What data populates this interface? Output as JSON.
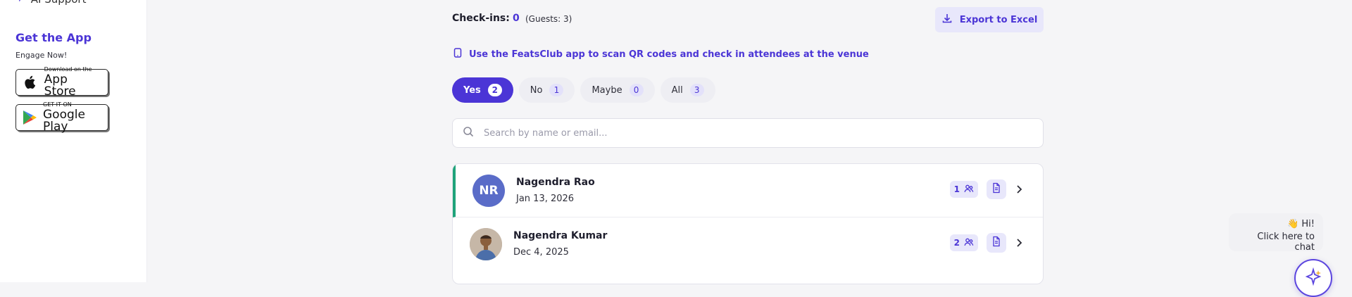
{
  "sidebar": {
    "cut_item_label": "AI Support",
    "get_app_title": "Get the App",
    "get_app_subtitle": "Engage Now!",
    "app_store": {
      "small": "Download on the",
      "big": "App Store"
    },
    "google_play": {
      "small": "GET IT ON",
      "big": "Google Play"
    }
  },
  "checkins": {
    "label": "Check-ins:",
    "count": "0",
    "guests_text": "(Guests: 3)",
    "export_label": "Export to Excel"
  },
  "tip": {
    "text": "Use the FeatsClub app to scan QR codes and check in attendees at the venue"
  },
  "filters": [
    {
      "label": "Yes",
      "count": "2",
      "active": true
    },
    {
      "label": "No",
      "count": "1",
      "active": false
    },
    {
      "label": "Maybe",
      "count": "0",
      "active": false
    },
    {
      "label": "All",
      "count": "3",
      "active": false
    }
  ],
  "search": {
    "placeholder": "Search by name or email..."
  },
  "attendees": [
    {
      "initials": "NR",
      "name": "Nagendra Rao",
      "date": "Jan 13, 2026",
      "guests": "1",
      "avatar_type": "initials",
      "avatar_color": "#5a6cc8"
    },
    {
      "initials": "",
      "name": "Nagendra Kumar",
      "date": "Dec 4, 2025",
      "guests": "2",
      "avatar_type": "photo",
      "avatar_color": "#c6b7a7"
    }
  ],
  "chat": {
    "greeting": "👋 Hi!",
    "cta": "Click here to chat"
  },
  "colors": {
    "accent": "#4b35d6",
    "active_border": "#1fa37a"
  },
  "icons": {
    "sidebar": "ai-support-icon",
    "export": "download-icon",
    "tip": "phone-icon",
    "search": "search-icon",
    "guest": "people-icon",
    "doc": "document-icon",
    "row_action": "chevron-right-icon",
    "chat": "sparkle-icon"
  }
}
